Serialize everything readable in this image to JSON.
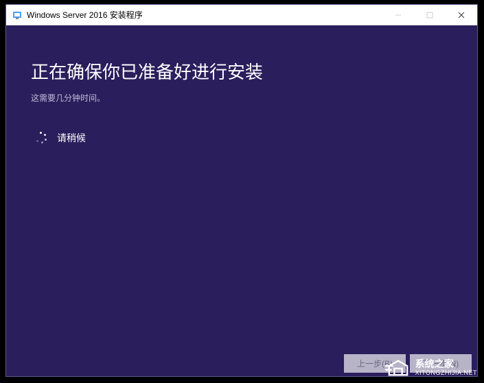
{
  "titlebar": {
    "title": "Windows Server 2016 安装程序"
  },
  "content": {
    "heading": "正在确保你已准备好进行安装",
    "subheading": "这需要几分钟时间。",
    "wait_text": "请稍候"
  },
  "footer": {
    "back_label": "上一步(B)",
    "next_label": "下一步(N)"
  },
  "watermark": {
    "cn": "系统之家",
    "en": "XITONGZHIJIA.NET"
  }
}
